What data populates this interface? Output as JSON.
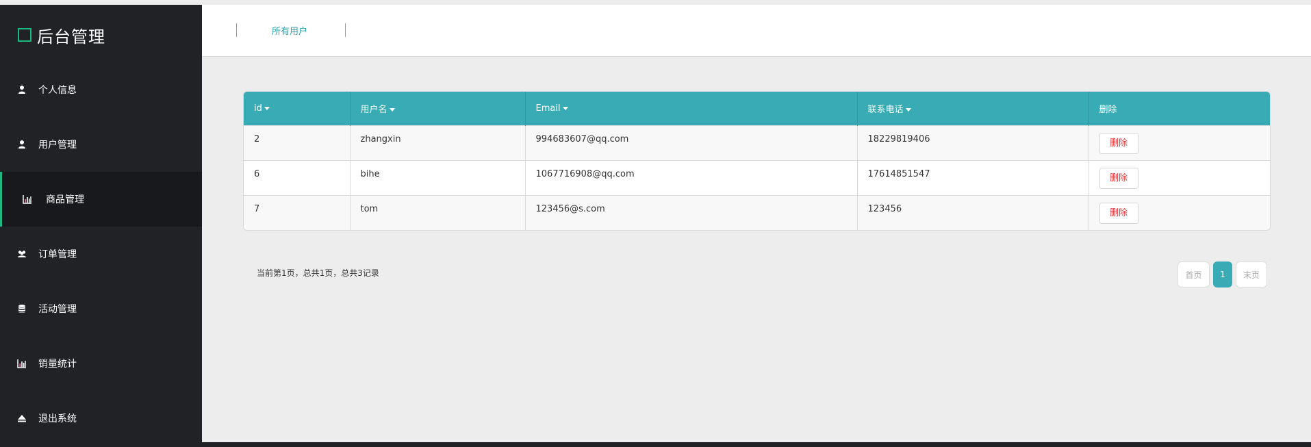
{
  "app": {
    "title": "后台管理"
  },
  "sidebar": {
    "items": [
      {
        "label": "个人信息",
        "icon": "user-icon",
        "active": false
      },
      {
        "label": "用户管理",
        "icon": "user-icon",
        "active": false
      },
      {
        "label": "商品管理",
        "icon": "bar-chart-icon",
        "active": true
      },
      {
        "label": "订单管理",
        "icon": "users-icon",
        "active": false
      },
      {
        "label": "活动管理",
        "icon": "database-icon",
        "active": false
      },
      {
        "label": "销量统计",
        "icon": "bar-chart-icon",
        "active": false
      },
      {
        "label": "退出系统",
        "icon": "eject-icon",
        "active": false
      }
    ]
  },
  "topbar": {
    "tab_label": "所有用户"
  },
  "table": {
    "headers": [
      {
        "label": "id",
        "sortable": true
      },
      {
        "label": "用户名",
        "sortable": true
      },
      {
        "label": "Email",
        "sortable": true
      },
      {
        "label": "联系电话",
        "sortable": true
      },
      {
        "label": "删除",
        "sortable": false
      }
    ],
    "rows": [
      {
        "id": "2",
        "username": "zhangxin",
        "email": "994683607@qq.com",
        "phone": "18229819406",
        "action": "删除"
      },
      {
        "id": "6",
        "username": "bihe",
        "email": "1067716908@qq.com",
        "phone": "17614851547",
        "action": "删除"
      },
      {
        "id": "7",
        "username": "tom",
        "email": "123456@s.com",
        "phone": "123456",
        "action": "删除"
      }
    ]
  },
  "pagination": {
    "info": "当前第1页，总共1页，总共3记录",
    "first": "首页",
    "current": "1",
    "last": "末页"
  },
  "colors": {
    "sidebar_bg": "#202226",
    "accent_green": "#1eb780",
    "table_header": "#39abb4",
    "delete_red": "#e4393c"
  }
}
